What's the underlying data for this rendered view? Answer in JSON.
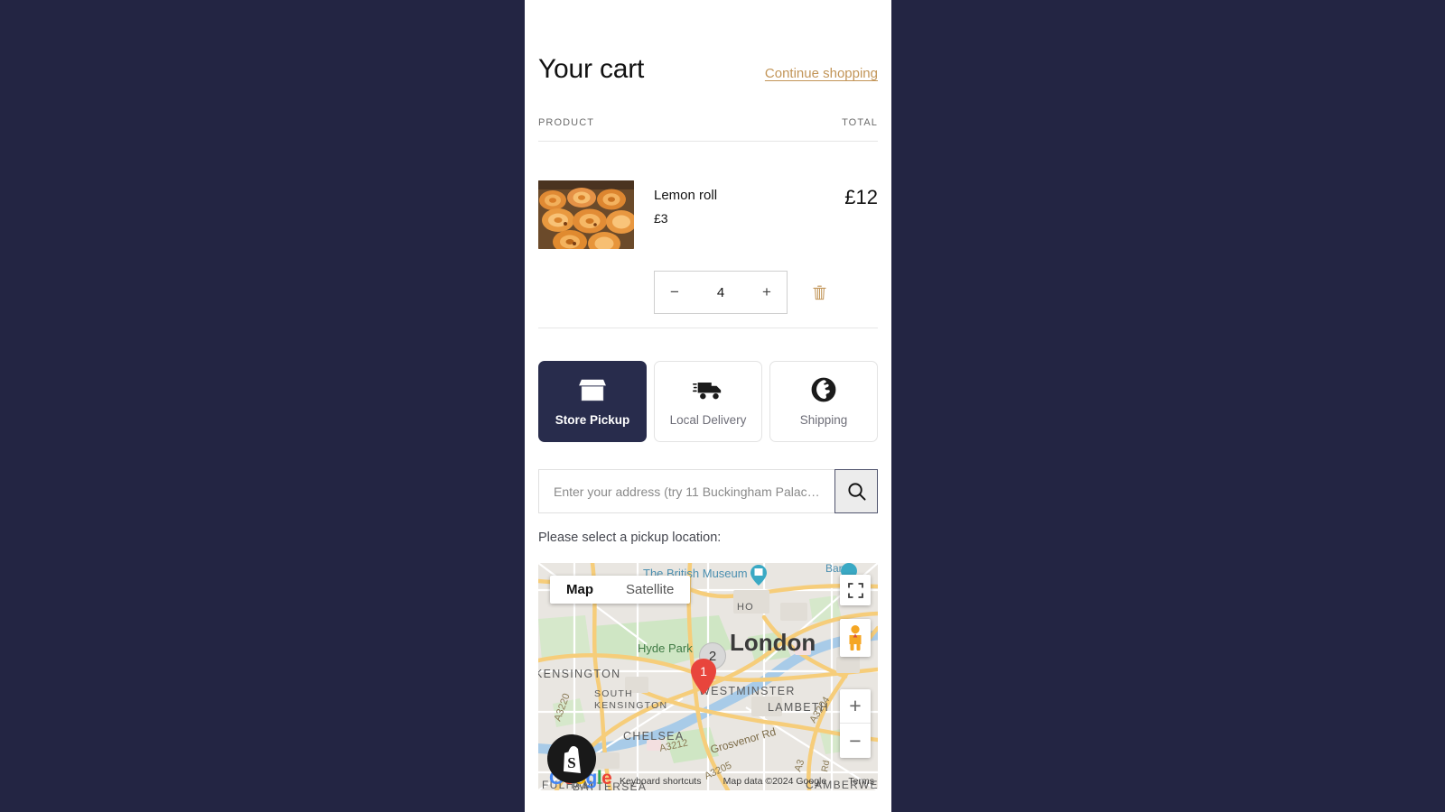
{
  "colors": {
    "page_background": "#232543",
    "panel_background": "#ffffff",
    "accent_link": "#c29558",
    "active_tab": "#282c4c",
    "text_primary": "#121212",
    "text_muted": "#6b6b6b",
    "marker_red": "#e8453c"
  },
  "cart": {
    "title": "Your cart",
    "continue_shopping": "Continue shopping",
    "columns": {
      "product": "PRODUCT",
      "total": "TOTAL"
    },
    "items": [
      {
        "title": "Lemon roll",
        "unit_price": "£3",
        "line_total": "£12",
        "quantity": "4",
        "decrease_label": "−",
        "increase_label": "+",
        "remove_label": "trash-icon",
        "image_alt": "Tray of glazed lemon rolls"
      }
    ]
  },
  "delivery": {
    "methods": [
      {
        "label": "Store Pickup",
        "icon": "storefront-icon",
        "active": true
      },
      {
        "label": "Local Delivery",
        "icon": "delivery-truck-icon",
        "active": false
      },
      {
        "label": "Shipping",
        "icon": "globe-icon",
        "active": false
      }
    ]
  },
  "address": {
    "placeholder": "Enter your address (try 11 Buckingham Palac…",
    "value": "",
    "search_icon": "magnifier-icon"
  },
  "pickup": {
    "hint": "Please select a pickup location:"
  },
  "map": {
    "type_buttons": [
      {
        "label": "Map",
        "selected": true
      },
      {
        "label": "Satellite",
        "selected": false
      }
    ],
    "controls": {
      "fullscreen": "fullscreen-icon",
      "street_view": "pegman-icon",
      "zoom_in": "+",
      "zoom_out": "−"
    },
    "markers": [
      {
        "id": "1",
        "type": "pin"
      },
      {
        "id": "2",
        "type": "cluster"
      }
    ],
    "labels": [
      "The British Museum",
      "SOHO",
      "London",
      "Hyde Park",
      "KENSINGTON",
      "SOUTH KENSINGTON",
      "WESTMINSTER",
      "LAMBETH",
      "CHELSEA",
      "Grosvenor Rd",
      "BATTERSEA",
      "FULHAM",
      "CAMBERWELL",
      "A3220",
      "A3212",
      "A3205",
      "A3204",
      "A3",
      "Bar"
    ],
    "watermark": "Google",
    "attribution": {
      "keyboard_shortcuts": "Keyboard shortcuts",
      "map_data": "Map data ©2024 Google",
      "terms": "Terms"
    },
    "brand_badge": "shopify-logo"
  }
}
